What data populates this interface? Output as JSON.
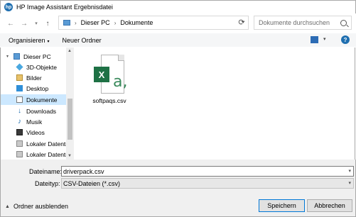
{
  "window": {
    "title": "HP Image Assistant Ergebnisdatei"
  },
  "navigation": {
    "back": "←",
    "forward": "→",
    "recent": "▾",
    "up": "↑",
    "breadcrumb": [
      "Dieser PC",
      "Dokumente"
    ],
    "breadcrumb_separator": "›",
    "address_dropdown": "▾",
    "refresh": "⟳",
    "search_placeholder": "Dokumente durchsuchen"
  },
  "toolbar": {
    "organize_label": "Organisieren",
    "organize_caret": "▾",
    "new_folder_label": "Neuer Ordner",
    "view_dropdown": "▾",
    "help": "?"
  },
  "sidebar": {
    "items": [
      {
        "label": "Dieser PC",
        "icon": "computer-icon"
      },
      {
        "label": "3D-Objekte",
        "icon": "3d-objects-icon"
      },
      {
        "label": "Bilder",
        "icon": "pictures-icon"
      },
      {
        "label": "Desktop",
        "icon": "desktop-icon"
      },
      {
        "label": "Dokumente",
        "icon": "documents-icon",
        "selected": true
      },
      {
        "label": "Downloads",
        "icon": "downloads-icon"
      },
      {
        "label": "Musik",
        "icon": "music-icon"
      },
      {
        "label": "Videos",
        "icon": "videos-icon"
      },
      {
        "label": "Lokaler Datenträ",
        "icon": "drive-icon"
      },
      {
        "label": "Lokaler Datenträ",
        "icon": "drive-icon"
      }
    ],
    "expand_glyph": "▾",
    "scroll_up": "▲",
    "scroll_down": "▼"
  },
  "files": [
    {
      "name": "softpaqs.csv",
      "icon": "excel-csv-icon",
      "badge_letter": "X",
      "overlay_letter": "a,"
    }
  ],
  "form": {
    "filename_label": "Dateiname:",
    "filename_value": "driverpack.csv",
    "filetype_label": "Dateityp:",
    "filetype_value": "CSV-Dateien (*.csv)",
    "dropdown": "▾"
  },
  "footer": {
    "hide_folders_label": "Ordner ausblenden",
    "hide_folders_caret": "▲",
    "save_label": "Speichern",
    "cancel_label": "Abbrechen"
  },
  "colors": {
    "accent": "#0078d7",
    "selection": "#cce8ff",
    "excel_green": "#1e7145"
  }
}
